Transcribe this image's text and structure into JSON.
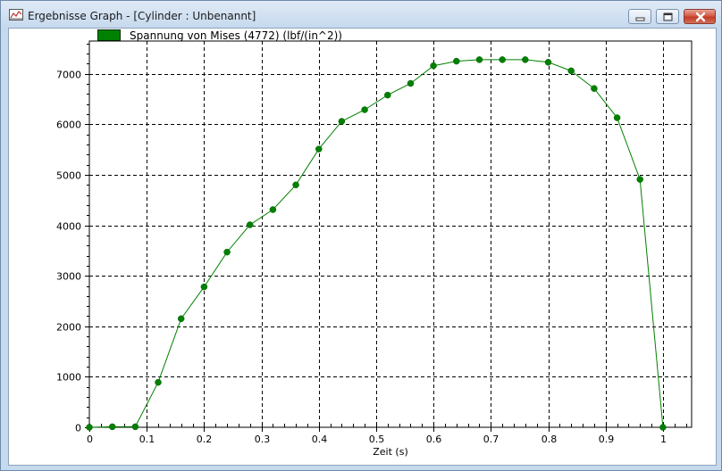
{
  "window": {
    "title": "Ergebnisse Graph - [Cylinder : Unbenannt]"
  },
  "legend": {
    "label": "Spannung von Mises (4772) (lbf/(in^2))",
    "color": "#008000"
  },
  "chart_data": {
    "type": "line",
    "xlabel": "Zeit (s)",
    "ylabel": "",
    "xlim": [
      0,
      1.05
    ],
    "ylim": [
      0,
      7650
    ],
    "xticks": [
      0,
      0.1,
      0.2,
      0.3,
      0.4,
      0.5,
      0.6,
      0.7,
      0.8,
      0.9,
      1
    ],
    "xtick_labels": [
      "0",
      "0.1",
      "0.2",
      "0.3",
      "0.4",
      "0.5",
      "0.6",
      "0.7",
      "0.8",
      "0.9",
      "1"
    ],
    "yticks": [
      0,
      1000,
      2000,
      3000,
      4000,
      5000,
      6000,
      7000
    ],
    "ytick_labels": [
      "0",
      "1000",
      "2000",
      "3000",
      "4000",
      "5000",
      "6000",
      "7000"
    ],
    "grid": true,
    "legend_position": "top-left",
    "series": [
      {
        "name": "Spannung von Mises (4772) (lbf/(in^2))",
        "color": "#008000",
        "x": [
          0,
          0.04,
          0.08,
          0.12,
          0.16,
          0.2,
          0.24,
          0.28,
          0.32,
          0.36,
          0.4,
          0.44,
          0.48,
          0.52,
          0.56,
          0.6,
          0.64,
          0.68,
          0.72,
          0.76,
          0.8,
          0.84,
          0.88,
          0.92,
          0.96,
          1.0
        ],
        "y": [
          0,
          10,
          10,
          890,
          2150,
          2780,
          3470,
          4010,
          4310,
          4800,
          5510,
          6060,
          6290,
          6580,
          6810,
          7160,
          7250,
          7280,
          7280,
          7280,
          7230,
          7060,
          6710,
          6130,
          4910,
          0
        ]
      }
    ]
  }
}
